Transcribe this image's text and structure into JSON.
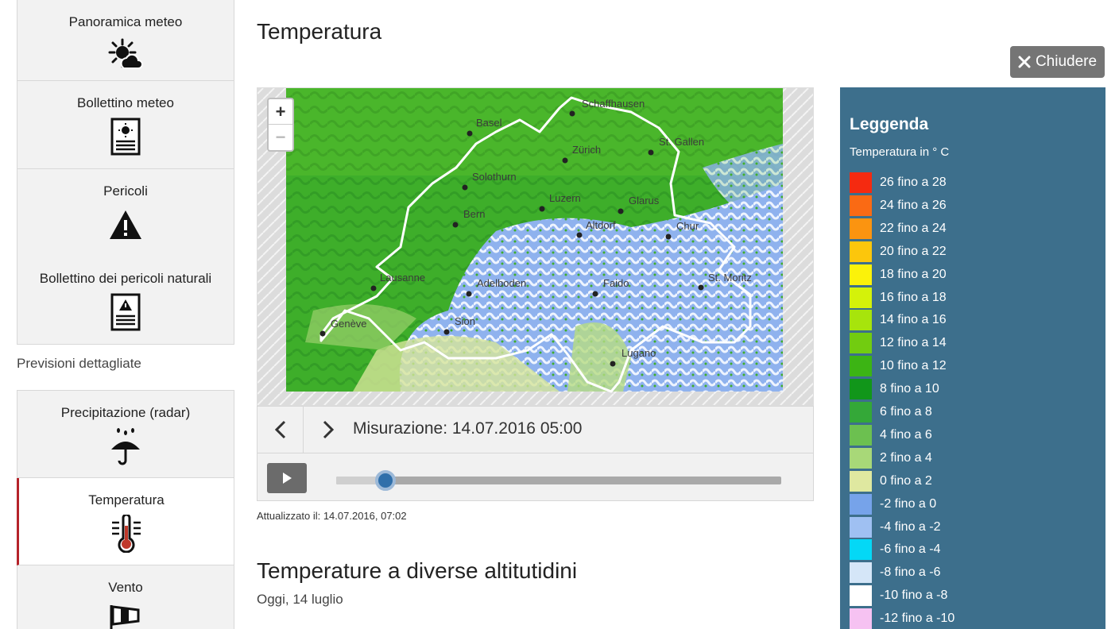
{
  "sidebar": {
    "items": [
      {
        "label": "Panoramica meteo",
        "icon": "sun-cloud-icon"
      },
      {
        "label": "Bollettino meteo",
        "icon": "weather-bulletin-icon"
      },
      {
        "label": "Pericoli",
        "icon": "warning-icon"
      },
      {
        "label": "Bollettino dei pericoli naturali",
        "icon": "hazard-bulletin-icon"
      },
      {
        "label": "Precipitazione (radar)",
        "icon": "rain-umbrella-icon"
      },
      {
        "label": "Temperatura",
        "icon": "thermometer-icon"
      },
      {
        "label": "Vento",
        "icon": "windsock-icon"
      }
    ],
    "section_label": "Previsioni dettagliate",
    "active_item": "Temperatura"
  },
  "main": {
    "title": "Temperatura",
    "close_label": "Chiudere",
    "map": {
      "cities": [
        "Schaffhausen",
        "Basel",
        "Zürich",
        "St. Gallen",
        "Solothurn",
        "Luzern",
        "Glarus",
        "Bern",
        "Altdorf",
        "Chur",
        "Lausanne",
        "Adelboden",
        "Faido",
        "St. Moritz",
        "Genève",
        "Sion",
        "Lugano"
      ],
      "zoom_in": "+",
      "zoom_out": "−"
    },
    "measurement": "Misurazione: 14.07.2016 05:00",
    "slider_position": 0.11,
    "updated": "Attualizzato il: 14.07.2016, 07:02",
    "section_title": "Temperature a diverse altitutidini",
    "section_subtitle": "Oggi, 14 luglio"
  },
  "legend": {
    "title": "Leggenda",
    "subtitle": "Temperatura in ° C",
    "entries": [
      {
        "label": "26 fino a 28",
        "color": "#f52a10"
      },
      {
        "label": "24 fino a 26",
        "color": "#fa6a14"
      },
      {
        "label": "22 fino a 24",
        "color": "#fb9410"
      },
      {
        "label": "20 fino a 22",
        "color": "#fcc60c"
      },
      {
        "label": "18 fino a 20",
        "color": "#fbf20a"
      },
      {
        "label": "16 fino a 18",
        "color": "#d4f20a"
      },
      {
        "label": "14 fino a 16",
        "color": "#a7e40c"
      },
      {
        "label": "12 fino a 14",
        "color": "#72cc10"
      },
      {
        "label": "10 fino a 12",
        "color": "#3cb414"
      },
      {
        "label": "8 fino a 10",
        "color": "#11961a"
      },
      {
        "label": "6 fino a 8",
        "color": "#34a838"
      },
      {
        "label": "4 fino a 6",
        "color": "#6cc050"
      },
      {
        "label": "2 fino a 4",
        "color": "#a8d878"
      },
      {
        "label": "0 fino a 2",
        "color": "#dfe8a0"
      },
      {
        "label": "-2 fino a 0",
        "color": "#76a3ea"
      },
      {
        "label": "-4 fino a -2",
        "color": "#9fc0f2"
      },
      {
        "label": "-6 fino a -4",
        "color": "#04d8f6"
      },
      {
        "label": "-8 fino a -6",
        "color": "#d5e6f8"
      },
      {
        "label": "-10 fino a -8",
        "color": "#ffffff"
      },
      {
        "label": "-12 fino a -10",
        "color": "#f6c2f2"
      }
    ]
  }
}
